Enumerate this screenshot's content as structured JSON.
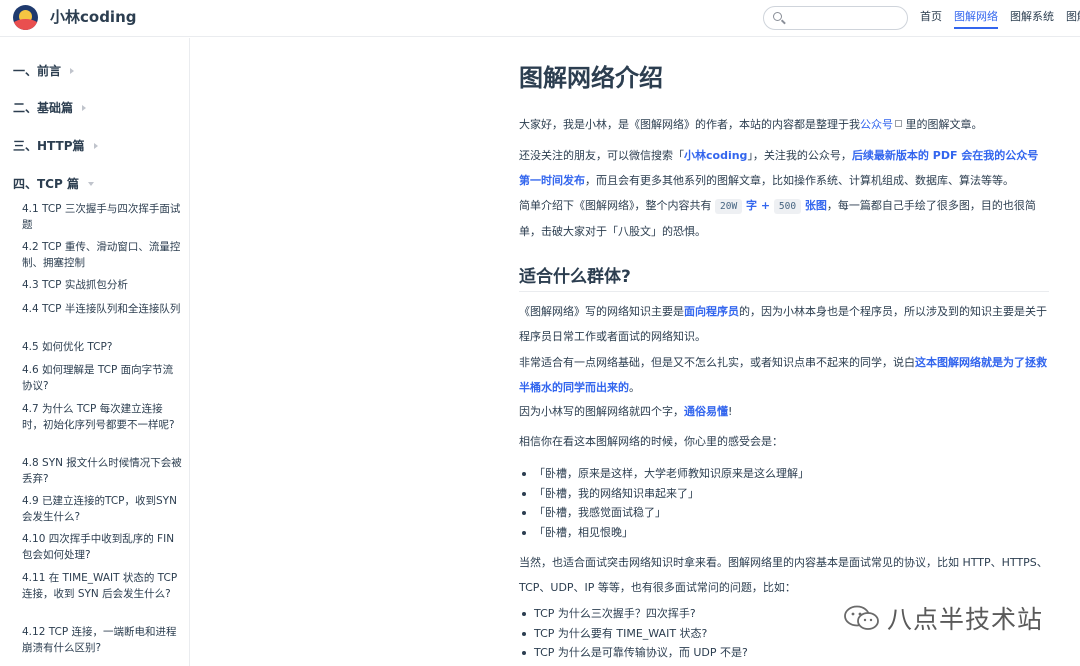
{
  "header": {
    "site_name": "小林coding",
    "search_placeholder": "",
    "nav": [
      "首页",
      "图解网络",
      "图解系统",
      "图解"
    ]
  },
  "sidebar": {
    "sections": [
      {
        "label": "一、前言",
        "expanded": false
      },
      {
        "label": "二、基础篇",
        "expanded": false
      },
      {
        "label": "三、HTTP篇",
        "expanded": false
      },
      {
        "label": "四、TCP 篇",
        "expanded": true
      }
    ],
    "items": [
      "4.1 TCP 三次握手与四次挥手面试题",
      "4.2 TCP 重传、滑动窗口、流量控制、拥塞控制",
      "4.3 TCP 实战抓包分析",
      "4.4 TCP 半连接队列和全连接队列",
      "4.5 如何优化 TCP?",
      "4.6 如何理解是 TCP 面向字节流协议?",
      "4.7 为什么 TCP 每次建立连接时，初始化序列号都要不一样呢?",
      "4.8 SYN 报文什么时候情况下会被丢弃?",
      "4.9 已建立连接的TCP，收到SYN会发生什么?",
      "4.10 四次挥手中收到乱序的 FIN 包会如何处理?",
      "4.11 在 TIME_WAIT 状态的 TCP 连接，收到 SYN 后会发生什么?",
      "4.12 TCP 连接，一端断电和进程崩溃有什么区别?"
    ]
  },
  "main": {
    "title": "图解网络介绍",
    "p1": {
      "a": "大家好，我是小林，是《图解网络》的作者，本站的内容都是整理于我",
      "link": "公众号",
      "b": "里的图解文章。"
    },
    "p2": {
      "a": "还没关注的朋友，可以微信搜索「",
      "name": "小林coding",
      "b": "」，关注我的公众号，",
      "bold": "后续最新版本的 PDF 会在我的公众号第一时间发布",
      "c": "，而且会有更多其他系列的图解文章，比如操作系统、计算机组成、数据库、算法等等。"
    },
    "p3": {
      "a": "简单介绍下《图解网络》，整个内容共有 ",
      "code1": "20W",
      "mid1": " 字 + ",
      "code2": "500",
      "mid2": " 张图",
      "b": "，每一篇都自己手绘了很多图，目的也很简单，击破大家对于「八股文」的恐惧。"
    },
    "h2": "适合什么群体?",
    "p4": {
      "a": "《图解网络》写的网络知识主要是",
      "bold": "面向程序员",
      "b": "的，因为小林本身也是个程序员，所以涉及到的知识主要是关于程序员日常工作或者面试的网络知识。"
    },
    "p5": {
      "a": "非常适合有一点网络基础，但是又不怎么扎实，或者知识点串不起来的同学，说白",
      "bold": "这本图解网络就是为了拯救半桶水的同学而出来的",
      "b": "。"
    },
    "p6": {
      "a": "因为小林写的图解网络就四个字，",
      "bold": "通俗易懂",
      "b": "!"
    },
    "p7": "相信你在看这本图解网络的时候，你心里的感受会是：",
    "feelings": [
      "「卧槽，原来是这样，大学老师教知识原来是这么理解」",
      "「卧槽，我的网络知识串起来了」",
      "「卧槽，我感觉面试稳了」",
      "「卧槽，相见恨晚」"
    ],
    "p8": "当然，也适合面试突击网络知识时拿来看。图解网络里的内容基本是面试常见的协议，比如 HTTP、HTTPS、TCP、UDP、IP 等等，也有很多面试常问的问题，比如：",
    "questions": [
      "TCP 为什么三次握手？四次挥手?",
      "TCP 为什么要有 TIME_WAIT 状态?",
      "TCP 为什么是可靠传输协议，而 UDP 不是?"
    ]
  },
  "watermark": "八点半技术站",
  "colors": {
    "accent": "#3366ee",
    "text": "#2c3e50",
    "border": "#eaecef"
  }
}
